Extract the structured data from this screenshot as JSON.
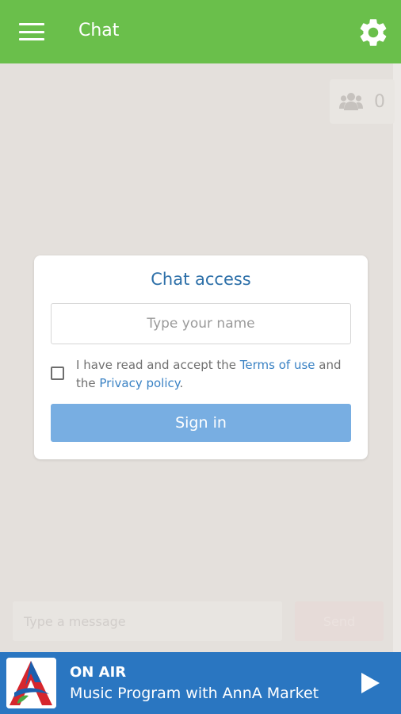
{
  "header": {
    "title": "Chat",
    "menu_icon": "hamburger-menu-icon",
    "settings_icon": "gear-icon",
    "color": "#6abf4b"
  },
  "users": {
    "icon": "users-icon",
    "count": "0"
  },
  "chat_access": {
    "title": "Chat access",
    "name_placeholder": "Type your name",
    "accept_prefix": "I have read and accept the ",
    "terms_link": "Terms of use",
    "accept_middle": " and the ",
    "privacy_link": "Privacy policy",
    "accept_suffix": ".",
    "checkbox_checked": false,
    "signin_label": "Sign in"
  },
  "composer": {
    "message_placeholder": "Type a message",
    "send_label": "Send"
  },
  "player": {
    "status": "ON AIR",
    "program": "Music Program with AnnA Market",
    "logo_icon": "station-logo-icon",
    "play_icon": "play-icon",
    "color": "#2a76c1"
  }
}
